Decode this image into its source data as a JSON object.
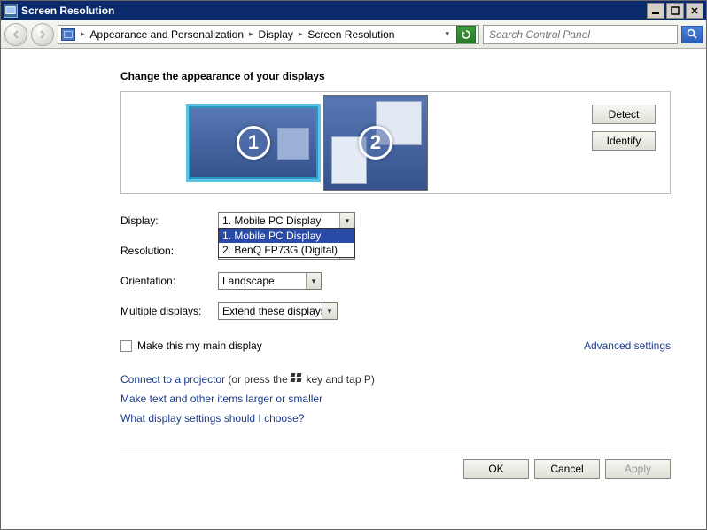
{
  "window": {
    "title": "Screen Resolution"
  },
  "nav": {
    "crumb1": "Appearance and Personalization",
    "crumb2": "Display",
    "crumb3": "Screen Resolution",
    "search_placeholder": "Search Control Panel"
  },
  "page": {
    "heading": "Change the appearance of your displays",
    "monitor1_num": "1",
    "monitor2_num": "2",
    "detect": "Detect",
    "identify": "Identify"
  },
  "form": {
    "display_label": "Display:",
    "display_value": "1. Mobile PC Display",
    "display_options": [
      "1. Mobile PC Display",
      "2. BenQ FP73G (Digital)"
    ],
    "resolution_label": "Resolution:",
    "orientation_label": "Orientation:",
    "orientation_value": "Landscape",
    "multiple_label": "Multiple displays:",
    "multiple_value": "Extend these displays",
    "maindisplay_label": "Make this my main display",
    "advanced": "Advanced settings"
  },
  "links": {
    "projector_a": "Connect to a projector",
    "projector_b": " (or press the ",
    "projector_c": " key and tap P)",
    "larger": "Make text and other items larger or smaller",
    "what": "What display settings should I choose?"
  },
  "buttons": {
    "ok": "OK",
    "cancel": "Cancel",
    "apply": "Apply"
  }
}
